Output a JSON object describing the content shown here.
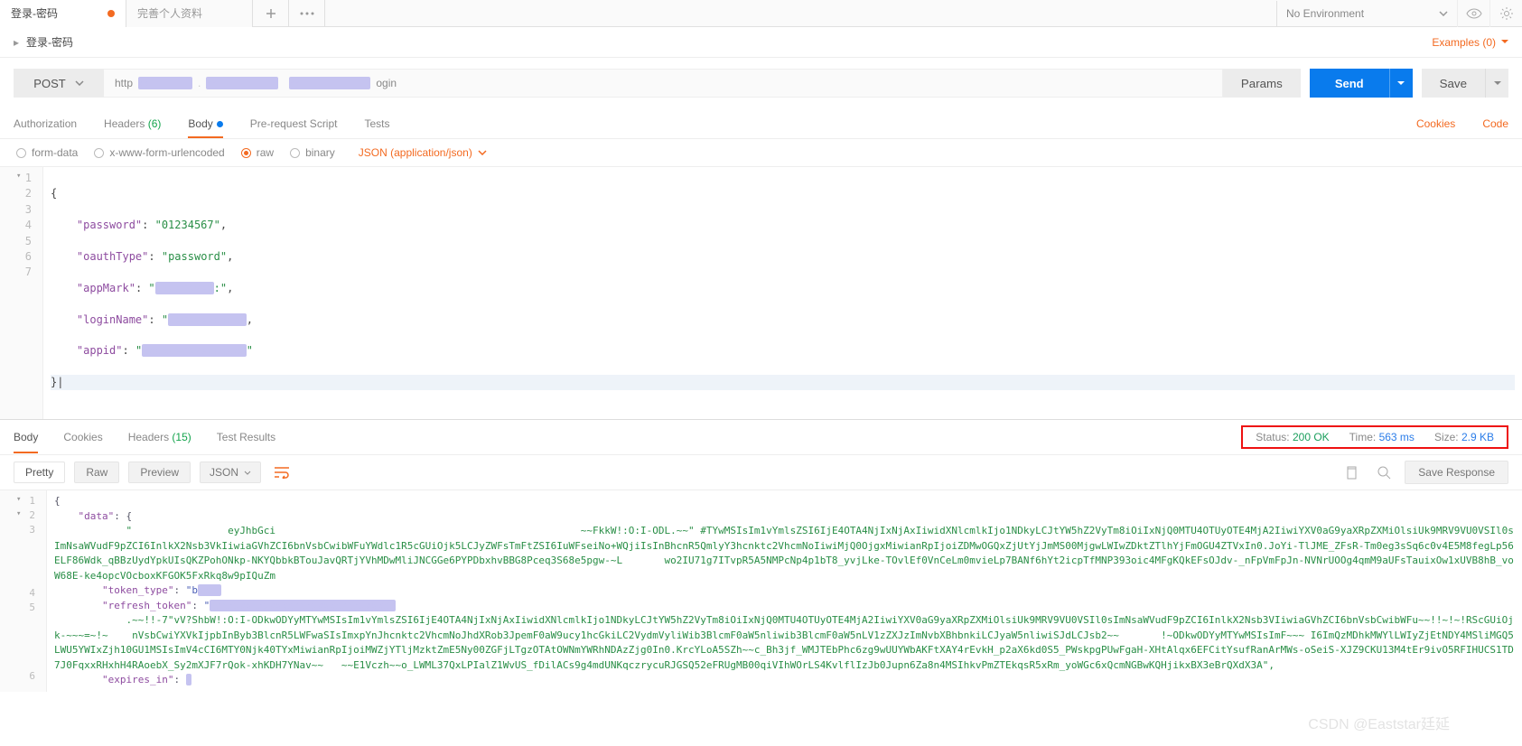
{
  "tabs": {
    "active": {
      "title": "登录-密码"
    },
    "inactive1": {
      "title": "完善个人资料"
    }
  },
  "environment": {
    "label": "No Environment"
  },
  "breadcrumb": {
    "title": "登录-密码"
  },
  "examples": {
    "label": "Examples (0)"
  },
  "request": {
    "method": "POST",
    "url_prefix": "http",
    "url_suffix": "ogin",
    "params": "Params",
    "send": "Send",
    "save": "Save"
  },
  "req_tabs": {
    "auth": "Authorization",
    "headers": "Headers",
    "headers_count": "(6)",
    "body": "Body",
    "prereq": "Pre-request Script",
    "tests": "Tests",
    "cookies": "Cookies",
    "code": "Code"
  },
  "body_types": {
    "form": "form-data",
    "url": "x-www-form-urlencoded",
    "raw": "raw",
    "binary": "binary",
    "json_label": "JSON (application/json)"
  },
  "req_body": {
    "l1": "{",
    "l2_k": "\"password\"",
    "l2_v": "\"01234567\"",
    "l3_k": "\"oauthType\"",
    "l3_v": "\"password\"",
    "l4_k": "\"appMark\"",
    "l5_k": "\"loginName\"",
    "l6_k": "\"appid\"",
    "l7": "}"
  },
  "resp_tabs": {
    "body": "Body",
    "cookies": "Cookies",
    "headers": "Headers",
    "headers_count": "(15)",
    "tests": "Test Results"
  },
  "status": {
    "status_label": "Status:",
    "status_value": "200 OK",
    "time_label": "Time:",
    "time_value": "563 ms",
    "size_label": "Size:",
    "size_value": "2.9 KB"
  },
  "resp_tools": {
    "pretty": "Pretty",
    "raw": "Raw",
    "preview": "Preview",
    "lang": "JSON",
    "save_resp": "Save Response"
  },
  "resp_body": {
    "l1": "{",
    "l2_k": "\"data\"",
    "l3_raw": "            \"                eyJhbGci                                                   ~~FkkW!:O:I-ODL.~~\" #TYwMSIsIm1vYmlsZSI6IjE4OTA4NjIxNjAxIiwidXNlcmlkIjo1NDkyLCJtYW5hZ2VyTm8iOiIxNjQ0MTU4OTUyOTE4MjA2IiwiYXV0aG9yaXRpZXMiOlsiUk9MRV9VU0VSIl0sImNsaWVudF9pZCI6InlkX2Nsb3VkIiwiaGVhZCI6bnVsbCwibWFuYWdlc1R5cGUiOjk5LCJyZWFsTmFtZSI6IuWFseiNo+WQjiIsInBhcnR5QmlyY3hcnktc2VhcmNoIiwiMjQ0OjgxMiwianRpIjoiZDMwOGQxZjUtYjJmMS00MjgwLWIwZDktZTlhYjFmOGU4ZTVxIn0.JoYi-TlJME_ZFsR-Tm0eg3sSq6c0v4E5M8fegLp56ELF86Wdk_qBBzUydYpkUIsQKZPohONkp-NKYQbbkBTouJavQRTjYVhMDwMliJNCGGe6PYPDbxhvBBG8Pceq3S68e5pgw-~L       wo2IU71g7ITvpR5A5NMPcNp4p1bT8_yvjLke-TOvlEf0VnCeLm0mvieLp7BANf6hYt2icpTfMNP393oic4MFgKQkEFsOJdv-_nFpVmFpJn-NVNrUOOg4qmM9aUFsTauixOw1xUVB8hB_voW68E-ke4opcVOcboxKFGOK5FxRkq8w9pIQuZm",
    "l4_k": "\"token_type\"",
    "l5_k": "\"refresh_token\"",
    "l5_raw": "            .~~!!-7\"vV?ShbW!:O:I-ODkwODYyMTYwMSIsIm1vYmlsZSI6IjE4OTA4NjIxNjAxIiwidXNlcmlkIjo1NDkyLCJtYW5hZ2VyTm8iOiIxNjQ0MTU4OTUyOTE4MjA2IiwiYXV0aG9yaXRpZXMiOlsiUk9MRV9VU0VSIl0sImNsaWVudF9pZCI6InlkX2Nsb3VIiwiaGVhZCI6bnVsbCwibWFu~~!!~!~!RScGUiOjk-~~~=~!~    nVsbCwiYXVkIjpbInByb3BlcnR5LWFwaSIsImxpYnJhcnktc2VhcmNoJhdXRob3JpemF0aW9ucy1hcGkiLC2VydmVyliWib3BlcmF0aW5nliwib3BlcmF0aW5nLV1zZXJzImNvbXBhbnkiLCJyaW5nliwiSJdLCJsb2~~       !~ODkwODYyMTYwMSIsImF~~~ I6ImQzMDhkMWYlLWIyZjEtNDY4MSliMGQ5LWU5YWIxZjh10GU1MSIsImV4cCI6MTY0Njk40TYxMiwianRpIjoiMWZjYTljMzktZmE5Ny00ZGFjLTgzOTAtOWNmYWRhNDAzZjg0In0.KrcYLoA5SZh~~c_Bh3jf_WMJTEbPhc6zg9wUUYWbAKFtXAY4rEvkH_p2aX6kd0S5_PWskpgPUwFgaH-XHtAlqx6EFCitYsufRanArMWs-oSeiS-XJZ9CKU13M4tEr9ivO5RFIHUCS1TD7J0FqxxRHxhH4RAoebX_Sy2mXJF7rQok-xhKDH7YNav~~   ~~E1Vczh~~o_LWML37QxLPIalZ1WvUS_fDilACs9g4mdUNKqczrycuRJGSQ52eFRUgMB00qiVIhWOrLS4KvlflIzJb0Jupn6Za8n4MSIhkvPmZTEkqsR5xRm_yoWGc6xQcmNGBwKQHjikxBX3eBrQXdX3A\",",
    "l6_k": "\"expires_in\""
  },
  "watermark": "CSDN @Eaststar廷延"
}
